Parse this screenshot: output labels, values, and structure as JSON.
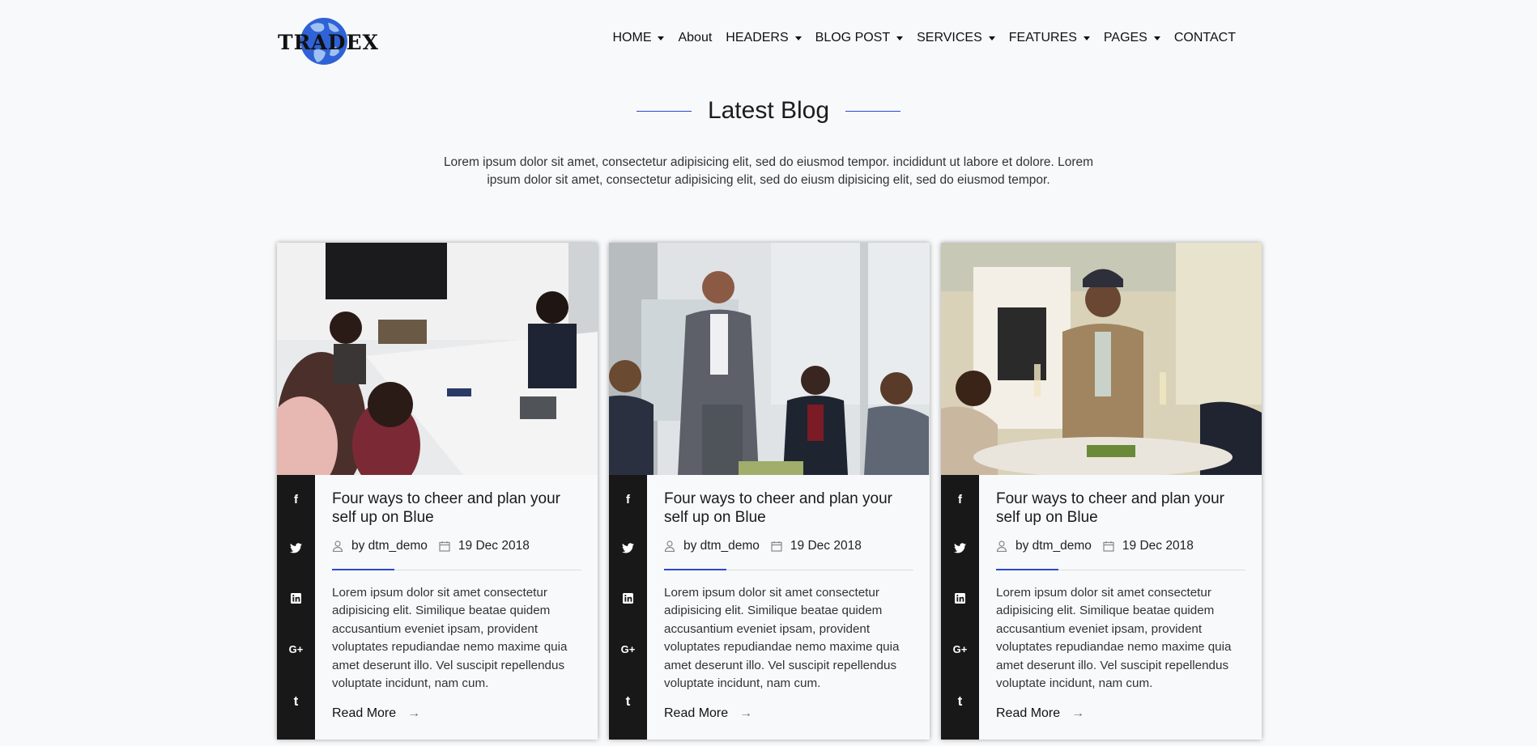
{
  "brand": {
    "logo_text": "TRADEX",
    "accent": "#2b47d4",
    "globe_color": "#2f62d6"
  },
  "nav": [
    {
      "label": "HOME",
      "has_dropdown": true
    },
    {
      "label": "About",
      "has_dropdown": false
    },
    {
      "label": "HEADERS",
      "has_dropdown": true
    },
    {
      "label": "BLOG POST",
      "has_dropdown": true
    },
    {
      "label": "SERVICES",
      "has_dropdown": true
    },
    {
      "label": "FEATURES",
      "has_dropdown": true
    },
    {
      "label": "PAGES",
      "has_dropdown": true
    },
    {
      "label": "CONTACT",
      "has_dropdown": false
    }
  ],
  "section": {
    "title": "Latest Blog",
    "intro": "Lorem ipsum dolor sit amet, consectetur adipisicing elit, sed do eiusmod tempor. incididunt ut labore et dolore. Lorem ipsum dolor sit amet, consectetur adipisicing elit, sed do eiusm dipisicing elit, sed do eiusmod tempor."
  },
  "social_icons": [
    "facebook-icon",
    "twitter-icon",
    "linkedin-icon",
    "google-plus-icon",
    "tumblr-icon"
  ],
  "posts": [
    {
      "image": "team-meeting-photo",
      "title": "Four ways to cheer and plan your self up on Blue",
      "author": "by dtm_demo",
      "date": "19 Dec 2018",
      "excerpt": "Lorem ipsum dolor sit amet consectetur adipisicing elit. Similique beatae quidem accusantium eveniet ipsam, provident voluptates repudiandae nemo maxime quia amet deserunt illo. Vel suscipit repellendus voluptate incidunt, nam cum.",
      "read_more": "Read More"
    },
    {
      "image": "presenter-office-photo",
      "title": "Four ways to cheer and plan your self up on Blue",
      "author": "by dtm_demo",
      "date": "19 Dec 2018",
      "excerpt": "Lorem ipsum dolor sit amet consectetur adipisicing elit. Similique beatae quidem accusantium eveniet ipsam, provident voluptates repudiandae nemo maxime quia amet deserunt illo. Vel suscipit repellendus voluptate incidunt, nam cum.",
      "read_more": "Read More"
    },
    {
      "image": "celebration-toast-photo",
      "title": "Four ways to cheer and plan your self up on Blue",
      "author": "by dtm_demo",
      "date": "19 Dec 2018",
      "excerpt": "Lorem ipsum dolor sit amet consectetur adipisicing elit. Similique beatae quidem accusantium eveniet ipsam, provident voluptates repudiandae nemo maxime quia amet deserunt illo. Vel suscipit repellendus voluptate incidunt, nam cum.",
      "read_more": "Read More"
    }
  ]
}
